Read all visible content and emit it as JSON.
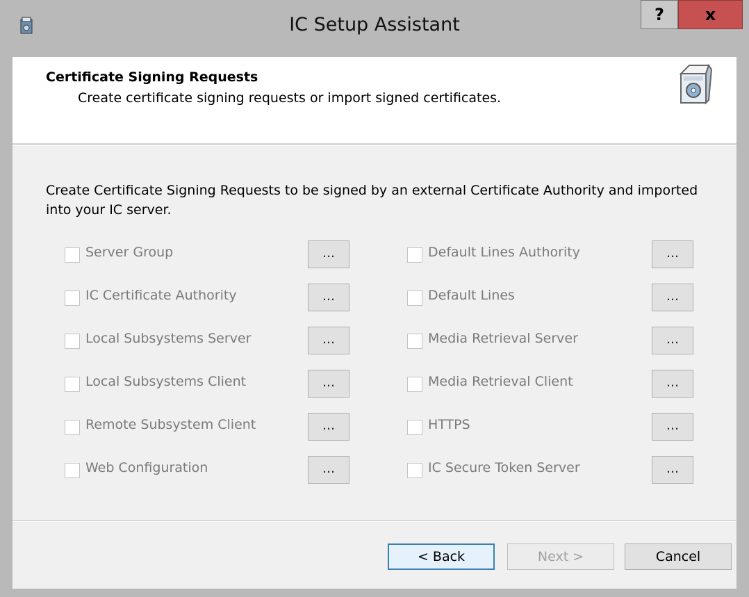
{
  "window": {
    "title": "IC Setup Assistant",
    "help_label": "?",
    "close_label": "x"
  },
  "header": {
    "title": "Certificate Signing Requests",
    "subtitle": "Create certificate signing requests or import signed certificates."
  },
  "body": {
    "description": "Create Certificate Signing Requests to be signed by an external Certificate Authority and imported into your IC server.",
    "browse_label": "...",
    "left_column": [
      {
        "label": "Server Group",
        "checked": false
      },
      {
        "label": "IC Certificate Authority",
        "checked": false
      },
      {
        "label": "Local Subsystems Server",
        "checked": false
      },
      {
        "label": "Local Subsystems Client",
        "checked": false
      },
      {
        "label": "Remote Subsystem Client",
        "checked": false
      },
      {
        "label": "Web Configuration",
        "checked": false
      }
    ],
    "right_column": [
      {
        "label": "Default Lines Authority",
        "checked": false
      },
      {
        "label": "Default Lines",
        "checked": false
      },
      {
        "label": "Media Retrieval Server",
        "checked": false
      },
      {
        "label": "Media Retrieval Client",
        "checked": false
      },
      {
        "label": "HTTPS",
        "checked": false
      },
      {
        "label": "IC Secure Token Server",
        "checked": false
      }
    ]
  },
  "footer": {
    "back_label": "< Back",
    "next_label": "Next >",
    "cancel_label": "Cancel"
  },
  "colors": {
    "title_bar": "#b9b9b9",
    "close_button": "#c75050",
    "disabled_text": "#7a7a7a",
    "default_button_border": "#3c7fb1"
  }
}
